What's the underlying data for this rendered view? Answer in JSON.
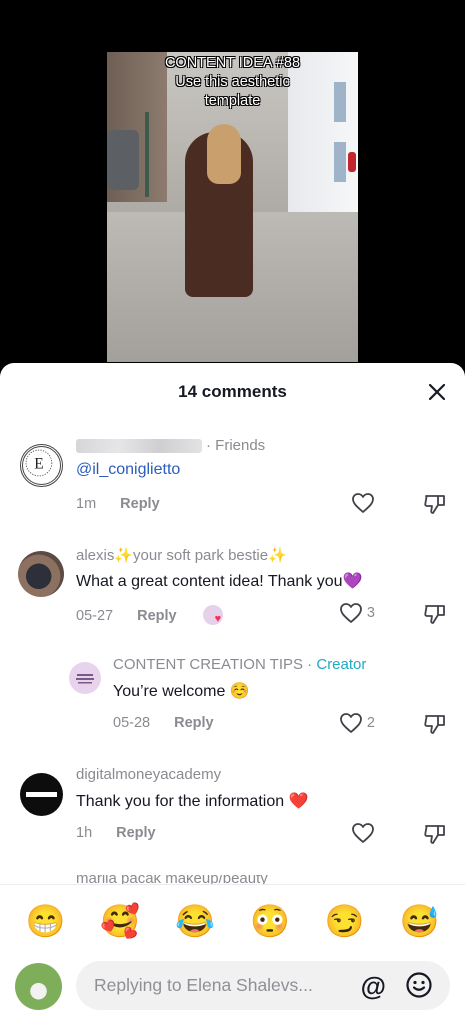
{
  "video": {
    "overlay_lines": [
      "CONTENT IDEA #88",
      "Use this aesthetic",
      "template"
    ]
  },
  "sheet": {
    "title": "14 comments",
    "close_icon": "close-icon"
  },
  "comments": [
    {
      "name_suffix": "· Friends",
      "text_mention": "@il_coniglietto",
      "time": "1m",
      "reply": "Reply",
      "like_count": ""
    },
    {
      "name": "alexis✨your soft park bestie✨",
      "text": "What a great content idea! Thank you💜",
      "time": "05-27",
      "reply": "Reply",
      "like_count": "3"
    },
    {
      "name": "CONTENT CREATION TIPS ·",
      "badge": "Creator",
      "text": "You’re welcome ☺️",
      "time": "05-28",
      "reply": "Reply",
      "like_count": "2"
    },
    {
      "name": "digitalmoneyacademy",
      "text": "Thank you for the information ❤️",
      "time": "1h",
      "reply": "Reply",
      "like_count": ""
    }
  ],
  "peek_name": "mariia pacak makeup/beauty",
  "emojis": [
    "😁",
    "🥰",
    "😂",
    "😳",
    "😏",
    "😅"
  ],
  "composer": {
    "placeholder": "Replying to Elena Shalevs...",
    "at_label": "@"
  },
  "colors": {
    "mention": "#2b5db9",
    "creator_badge": "#20a9c2",
    "secondary_text": "#8a8b91"
  }
}
